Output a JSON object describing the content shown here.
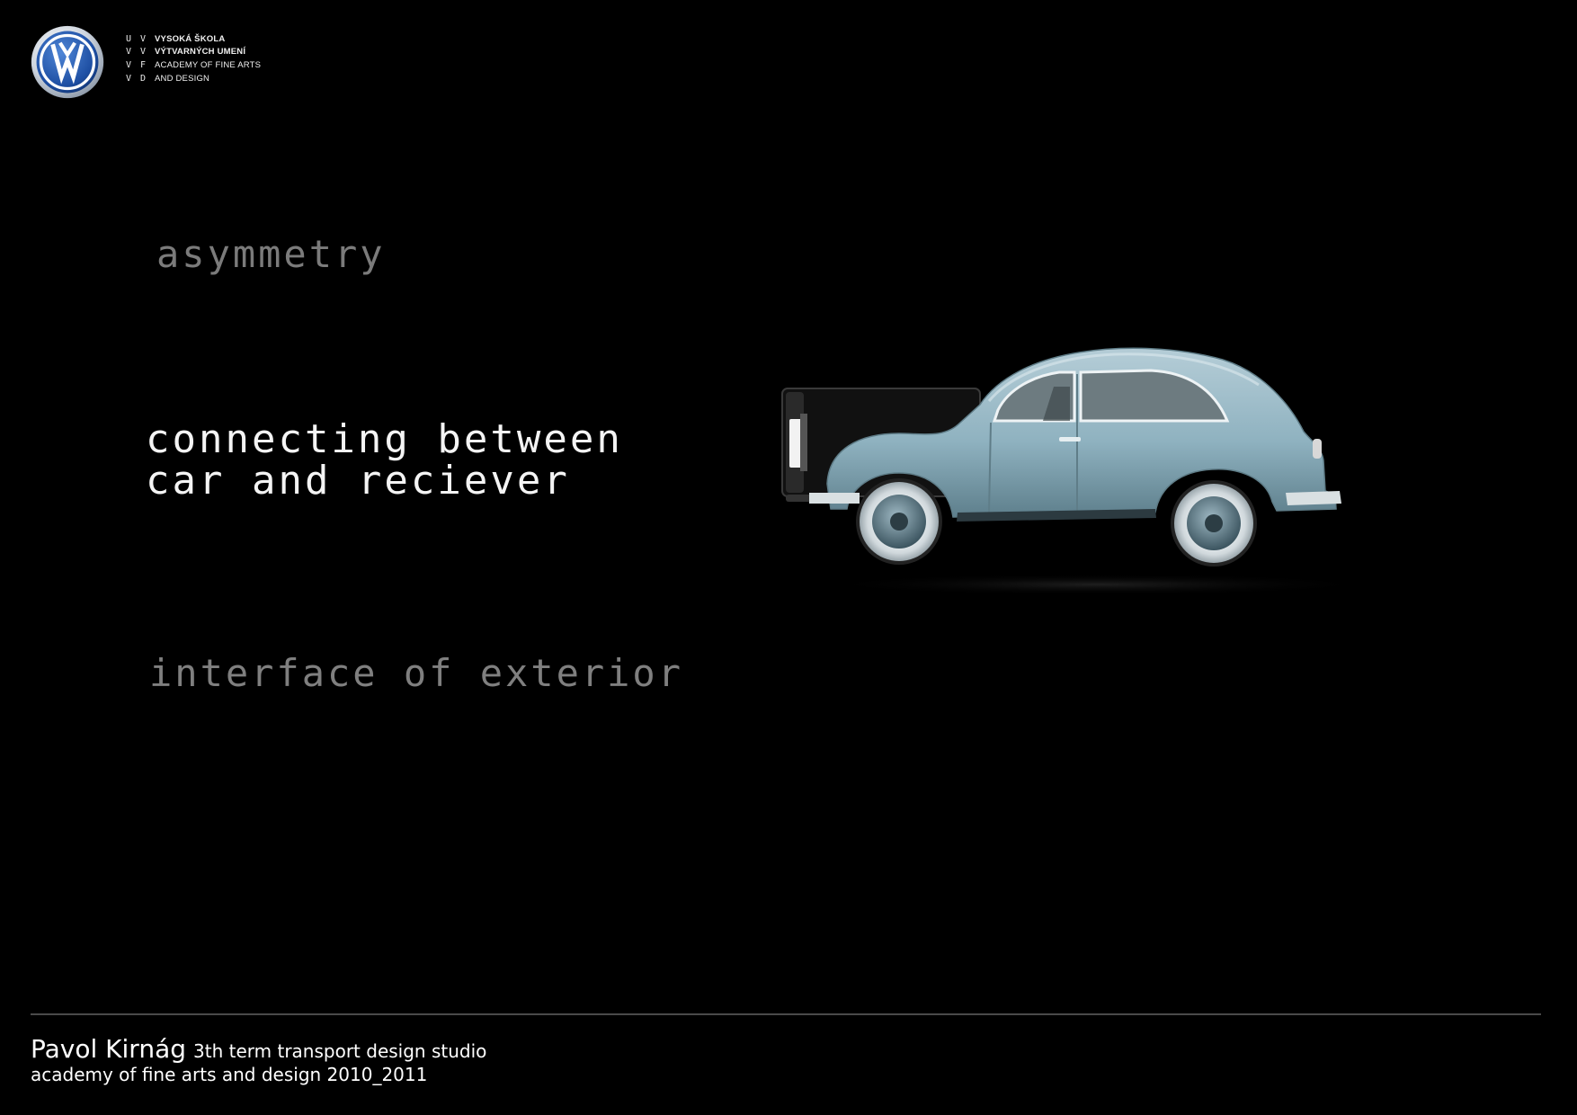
{
  "header": {
    "logo_icon": "volkswagen-logo",
    "school": {
      "monogram_rows": [
        [
          "U",
          "V"
        ],
        [
          "V",
          "V"
        ],
        [
          "V",
          "F"
        ],
        [
          "V",
          "D"
        ]
      ],
      "line1": "VYSOKÁ ŠKOLA",
      "line2": "VÝTVARNÝCH UMENÍ",
      "line3": "ACADEMY OF FINE ARTS",
      "line4": "AND DESIGN"
    }
  },
  "main": {
    "heading_1": "asymmetry",
    "heading_2_line1": "connecting between",
    "heading_2_line2": "car and reciever",
    "heading_3": "interface of exterior",
    "image_icon": "vw-beetle-car-with-trailer-illustration"
  },
  "footer": {
    "author": "Pavol Kirnág",
    "course": "3th term transport design studio",
    "institution_year": "academy of fine arts and design 2010_2011"
  },
  "colors": {
    "background": "#000000",
    "text_primary": "#f4f4f4",
    "text_muted": "#7b7b7b",
    "car_body": "#8fb2c0",
    "vw_blue": "#1e4fa3"
  }
}
